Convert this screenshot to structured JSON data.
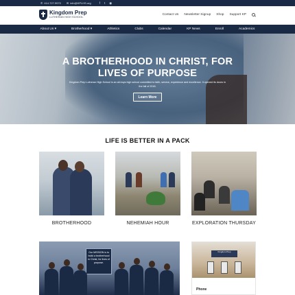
{
  "topbar": {
    "phone": "414.727.9970",
    "email": "info@KPLHS.org",
    "social": [
      "f",
      "t",
      "◉"
    ]
  },
  "header": {
    "logo_name": "Kingdom Prep",
    "logo_sub": "LUTHERAN HIGH SCHOOL",
    "util_nav": [
      "Contact Us",
      "Newsletter Signup",
      "Shop",
      "Support KP"
    ]
  },
  "mainnav": [
    "About Us ▾",
    "Brotherhood ▾",
    "Athletics",
    "Clubs",
    "Calendar",
    "KP News",
    "Enroll",
    "Academics"
  ],
  "hero": {
    "title_line1": "A BROTHERHOOD IN CHRIST, FOR",
    "title_line2": "LIVES OF PURPOSE",
    "text": "Kingdom Prep Lutheran High School is an all-boys high school committed to faith, service, experience and excellence. It opened its doors in the fall of 2018.",
    "button": "Learn More"
  },
  "section": {
    "title": "LIFE IS BETTER IN A PACK"
  },
  "cards": [
    {
      "caption": "BROTHERHOOD"
    },
    {
      "caption": "NEHEMIAH HOUR"
    },
    {
      "caption": "EXPLORATION THURSDAY"
    }
  ],
  "bottom": {
    "sign_text": "Our MISSION is to build a brotherhood in Christ, for lives of purpose.",
    "building_sign": "Kingdom Prep",
    "phone_label": "Phone"
  },
  "colors": {
    "navy": "#1b2a44",
    "white": "#ffffff"
  }
}
